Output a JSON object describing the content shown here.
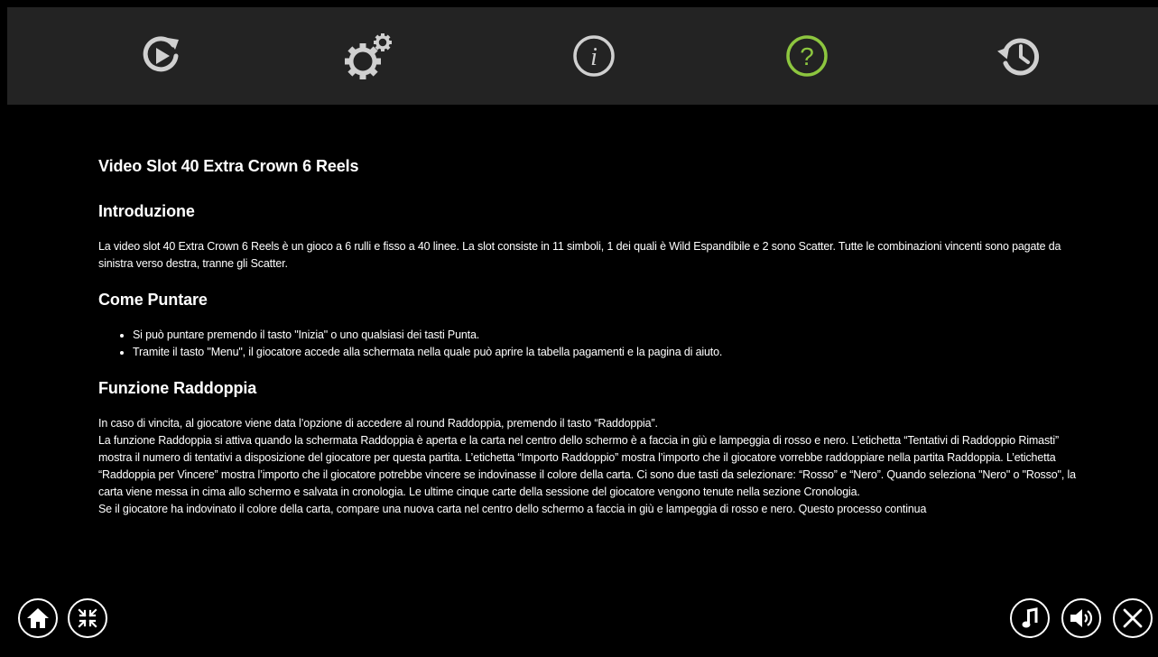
{
  "toolbar": {
    "items": [
      {
        "icon": "autoplay-icon",
        "active": false
      },
      {
        "icon": "gear-icon",
        "active": false
      },
      {
        "icon": "info-icon",
        "active": false
      },
      {
        "icon": "help-icon",
        "active": true
      },
      {
        "icon": "history-icon",
        "active": false
      }
    ],
    "active_color": "#8dc63f",
    "icon_color": "#d0d0d0"
  },
  "help": {
    "title": "Video Slot 40 Extra Crown 6 Reels",
    "intro_heading": "Introduzione",
    "intro_text": "La video slot 40 Extra Crown 6 Reels è un gioco a 6 rulli e fisso a 40 linee. La slot consiste in 11 simboli, 1 dei quali è Wild Espandibile e 2 sono Scatter. Tutte le combinazioni vincenti sono pagate da sinistra verso destra, tranne gli Scatter.",
    "bet_heading": "Come Puntare",
    "bet_items": [
      "Si può puntare premendo il tasto \"Inizia\" o uno qualsiasi dei tasti Punta.",
      "Tramite il tasto \"Menu\", il giocatore accede alla schermata nella quale può aprire la tabella pagamenti e la pagina di aiuto."
    ],
    "double_heading": "Funzione Raddoppia",
    "double_p1": "In caso di vincita, al giocatore viene data l’opzione di accedere al round Raddoppia, premendo il tasto “Raddoppia”.",
    "double_p2": "La funzione Raddoppia si attiva quando la schermata Raddoppia è aperta e la carta nel centro dello schermo è a faccia in giù e lampeggia di rosso e nero. L’etichetta “Tentativi di Raddoppio Rimasti” mostra il numero di tentativi a disposizione del giocatore per questa partita. L’etichetta “Importo Raddoppio” mostra l’importo che il giocatore vorrebbe raddoppiare nella partita Raddoppia. L’etichetta “Raddoppia per Vincere” mostra l’importo che il giocatore potrebbe vincere se indovinasse il colore della carta. Ci sono due tasti da selezionare: “Rosso” e “Nero”. Quando seleziona \"Nero\" o \"Rosso\", la carta viene messa in cima allo schermo e salvata in cronologia. Le ultime cinque carte della sessione del giocatore vengono tenute nella sezione Cronologia.",
    "double_p3": "Se il giocatore ha indovinato il colore della carta, compare una nuova carta nel centro dello schermo a faccia in giù e lampeggia di rosso e nero. Questo processo continua"
  },
  "bottom_controls": {
    "left": [
      "home-icon",
      "minimize-icon"
    ],
    "right": [
      "music-icon",
      "sound-icon",
      "close-icon"
    ]
  }
}
